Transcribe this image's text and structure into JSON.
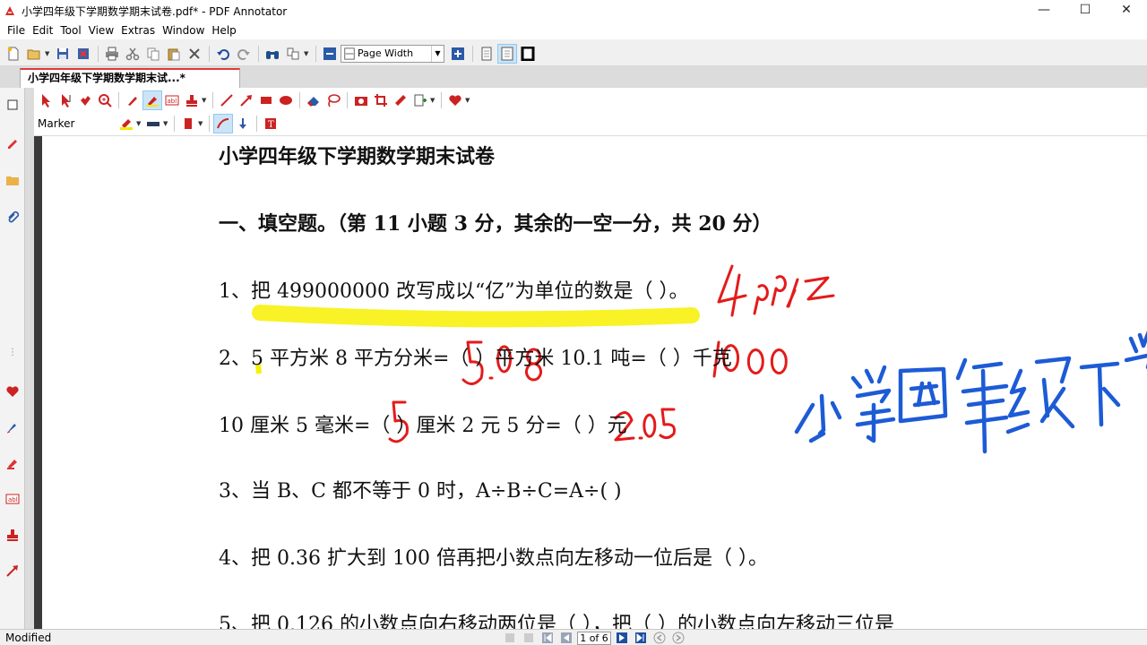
{
  "window": {
    "title": "小学四年级下学期数学期末试卷.pdf* - PDF Annotator",
    "min_glyph": "—",
    "max_glyph": "☐",
    "close_glyph": "✕"
  },
  "menu": [
    "File",
    "Edit",
    "Tool",
    "View",
    "Extras",
    "Window",
    "Help"
  ],
  "toolbar": {
    "zoom_value": "Page Width"
  },
  "tab": {
    "label": "小学四年级下学期数学期末试...*"
  },
  "annotation_toolbar": {
    "tool_label": "Marker",
    "marker_color": "#f5e900",
    "line_color": "#c0302f"
  },
  "document": {
    "title": "小学四年级下学期数学期末试卷",
    "section_heading": "一、填空题。（第 11 小题 3 分，其余的一空一分，共 20 分）",
    "lines": [
      "1、把 499000000 改写成以“亿”为单位的数是（    ）。",
      "2、5 平方米 8 平方分米=（    ）平方米  10.1 吨=（    ）千克",
      "10 厘米 5 毫米=（    ）厘米  2 元 5 分=（    ）元",
      "3、当 B、C 都不等于 0 时，A÷B÷C=A÷(  )",
      "4、把 0.36 扩大到 100 倍再把小数点向左移动一位后是（  ）。",
      "5、把 0.126 的小数点向右移动两位是（  ），把（  ）的小数点向左移动三位是"
    ],
    "highlight_color": "#f7f000",
    "ink_red": "#e31b1b",
    "ink_blue": "#1d5bd6"
  },
  "status": {
    "text": "Modified",
    "page_indicator": "1 of 6"
  }
}
